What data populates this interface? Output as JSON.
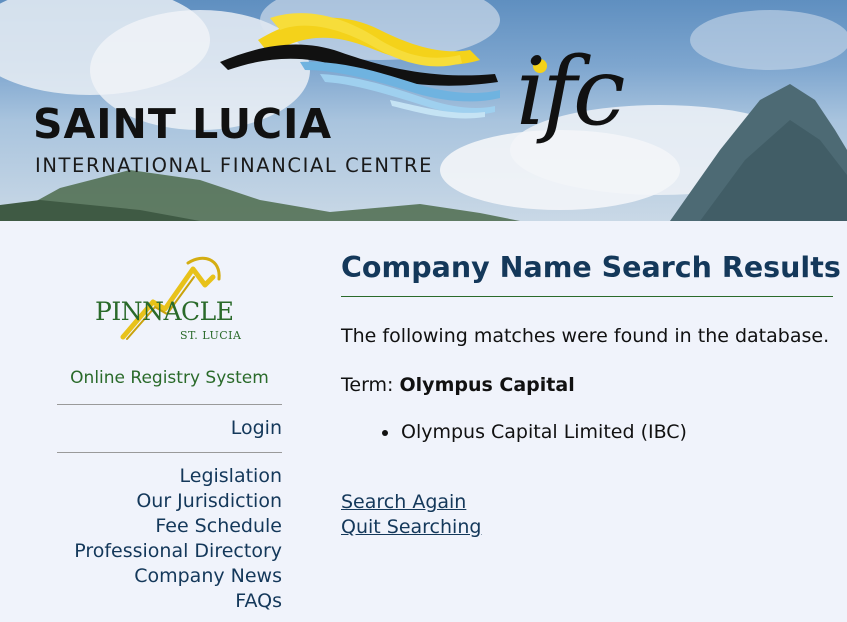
{
  "banner": {
    "title": "SAINT LUCIA",
    "subtitle": "INTERNATIONAL FINANCIAL CENTRE",
    "ifc_mark": "ifc"
  },
  "sidebar": {
    "logo_name": "PINNACLE",
    "logo_sub": "ST. LUCIA",
    "registry_title": "Online Registry System",
    "login": "Login",
    "nav": [
      {
        "label": "Legislation"
      },
      {
        "label": "Our Jurisdiction"
      },
      {
        "label": "Fee Schedule"
      },
      {
        "label": "Professional Directory"
      },
      {
        "label": "Company News"
      },
      {
        "label": "FAQs"
      }
    ]
  },
  "main": {
    "title": "Company Name Search Results",
    "intro": "The following matches were found in the database.",
    "term_label": "Term:",
    "term_value": "Olympus Capital",
    "results": [
      "Olympus Capital Limited (IBC)"
    ],
    "search_again": "Search Again",
    "quit_searching": "Quit Searching"
  },
  "colors": {
    "page_bg": "#f0f3fb",
    "heading": "#14385a",
    "green": "#2a6a2a",
    "link": "#14385a"
  }
}
